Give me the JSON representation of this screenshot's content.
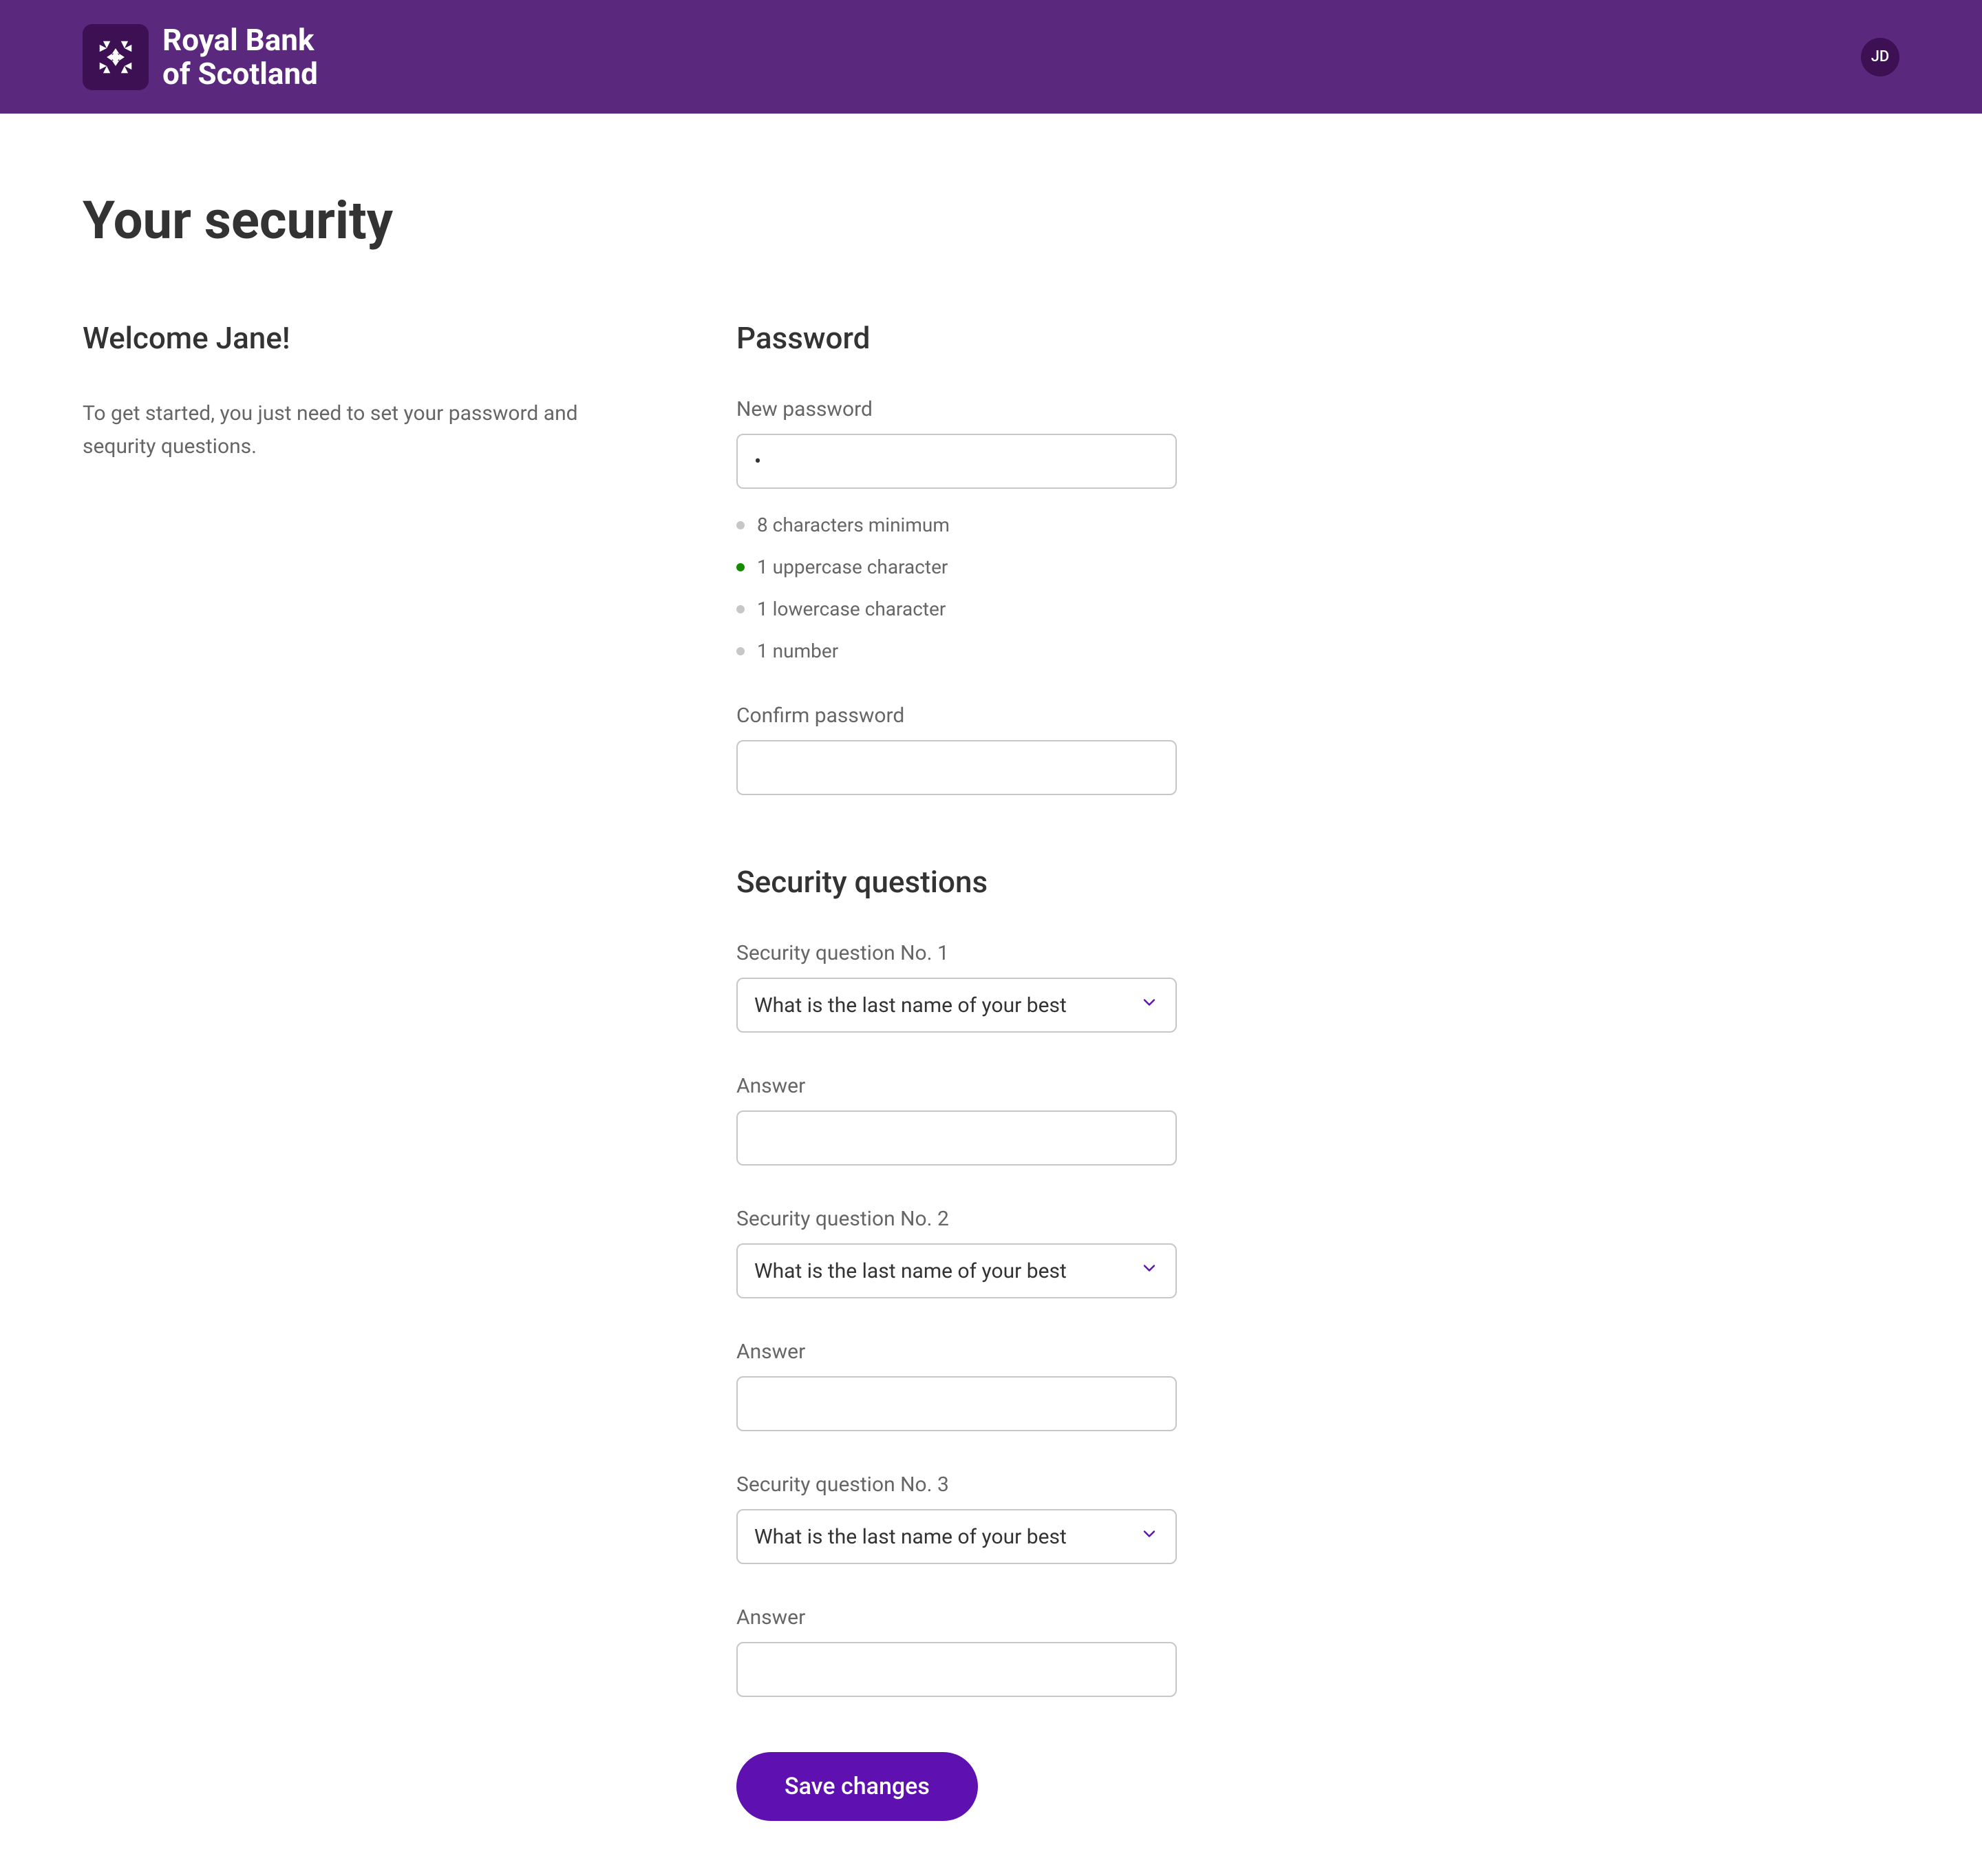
{
  "header": {
    "brand_line1": "Royal Bank",
    "brand_line2": "of Scotland",
    "avatar_initials": "JD"
  },
  "page": {
    "title": "Your security"
  },
  "welcome": {
    "heading": "Welcome Jane!",
    "intro": "To get started, you just need to set your password and sequrity questions."
  },
  "password": {
    "heading": "Password",
    "new_label": "New password",
    "new_value": "•",
    "confirm_label": "Confirm password",
    "confirm_value": "",
    "rules": [
      {
        "text": "8 characters minimum",
        "met": false
      },
      {
        "text": "1 uppercase character",
        "met": true
      },
      {
        "text": "1 lowercase character",
        "met": false
      },
      {
        "text": "1 number",
        "met": false
      }
    ]
  },
  "security": {
    "heading": "Security questions",
    "questions": [
      {
        "label": "Security question No. 1",
        "selected": "What is the last name of your best",
        "answer_label": "Answer",
        "answer_value": ""
      },
      {
        "label": "Security question No. 2",
        "selected": "What is the last name of your best",
        "answer_label": "Answer",
        "answer_value": ""
      },
      {
        "label": "Security question No. 3",
        "selected": "What is the last name of your best",
        "answer_label": "Answer",
        "answer_value": ""
      }
    ]
  },
  "actions": {
    "save_label": "Save changes"
  },
  "colors": {
    "brand_primary": "#5A287D",
    "brand_dark": "#3C1053",
    "accent": "#5E10B1",
    "success": "#158B00"
  }
}
